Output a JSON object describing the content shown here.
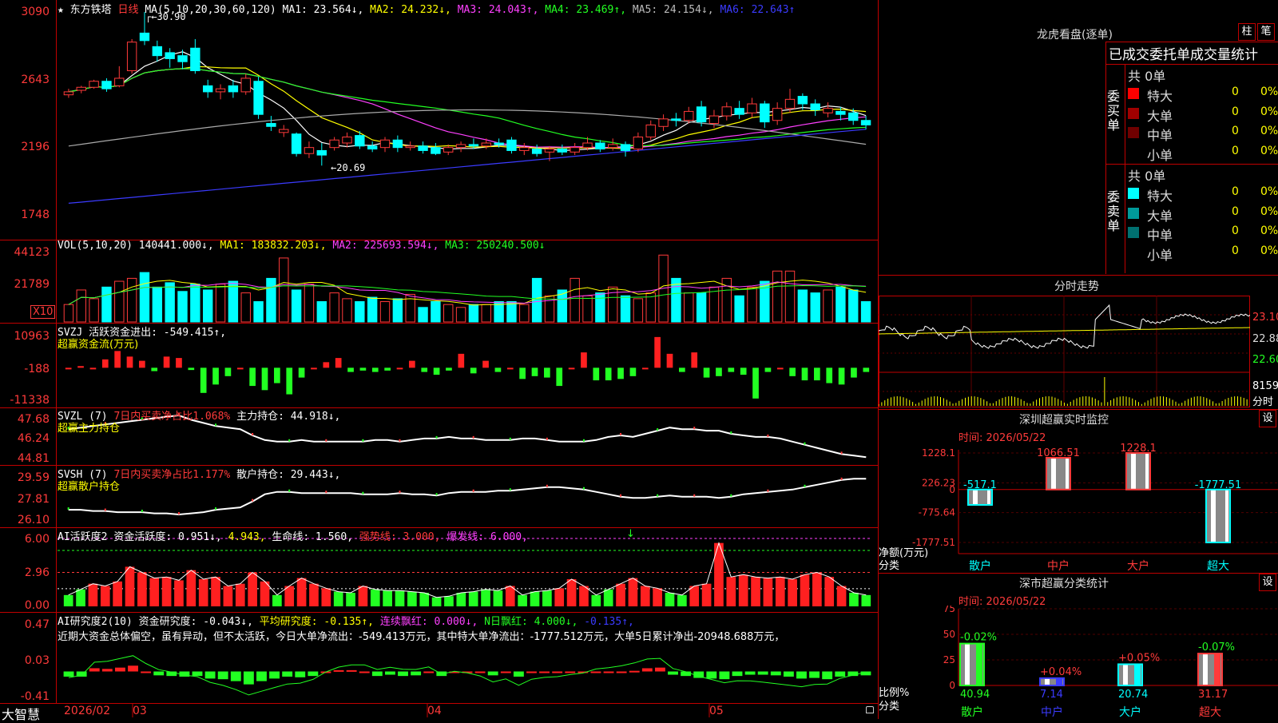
{
  "header": {
    "stock_name": "东方铁塔",
    "period": "日线",
    "ma_label": "MA(5,10,20,30,60,120)",
    "ma1": "MA1: 23.564↓,",
    "ma2": "MA2: 24.232↓,",
    "ma3": "MA3: 24.043↑,",
    "ma4": "MA4: 23.469↑,",
    "ma5": "MA5: 24.154↓,",
    "ma6": "MA6: 22.643↑"
  },
  "price_panel": {
    "ticks": [
      "3090",
      "2643",
      "2196",
      "1748"
    ],
    "high_note": "30.90",
    "low_note": "←20.69"
  },
  "vol_panel": {
    "label": "VOL(5,10,20)",
    "value": "140441.000↓,",
    "ma1": "MA1: 183832.203↓,",
    "ma2": "MA2: 225693.594↓,",
    "ma3": "MA3: 250240.500↓",
    "ticks": [
      "44123",
      "21789"
    ],
    "unit": "X10"
  },
  "svzj_panel": {
    "label": "SVZJ",
    "title": "活跃资金进出: -549.415↑,",
    "subtitle": "超赢资金流(万元)",
    "ticks": [
      "10963",
      "-188",
      "-11338"
    ]
  },
  "svzl_panel": {
    "label": "SVZL (7)",
    "ratio": "7日内买卖净占比1.068%",
    "value": "主力持仓: 44.918↓,",
    "subtitle": "超赢主力持仓",
    "ticks": [
      "47.68",
      "46.24",
      "44.81"
    ]
  },
  "svsh_panel": {
    "label": "SVSH (7)",
    "ratio": "7日内买卖净占比1.177%",
    "value": "散户持仓: 29.443↓,",
    "subtitle": "超赢散户持仓",
    "ticks": [
      "29.59",
      "27.81",
      "26.10"
    ]
  },
  "ai_active_panel": {
    "label": "AI活跃度2",
    "v1": "资金活跃度: 0.951↓,",
    "v2": "4.943,",
    "v3": "生命线: 1.560,",
    "v4": "强势线: 3.000,",
    "v5": "爆发线: 6.000,",
    "ticks": [
      "6.00",
      "2.96",
      "0.00"
    ]
  },
  "ai_research_panel": {
    "label": "AI研究度2(10)",
    "v1": "资金研究度: -0.043↓,",
    "v2": "平均研究度: -0.135↑,",
    "v3": "连续飘红: 0.000↓,",
    "v4": "N日飘红: 4.000↓,",
    "v5": "-0.135↑,",
    "note": "近期大资金总体偏空，虽有异动，但不太活跃，今日大单净流出：-549.413万元，其中特大单净流出：-1777.512万元，大单5日累计净出-20948.688万元，",
    "ticks": [
      "0.47",
      "0.03",
      "-0.41"
    ]
  },
  "x_axis": {
    "brand": "大智慧",
    "labels": [
      "2026/02",
      "03",
      "04",
      "05"
    ]
  },
  "right": {
    "dragon_title": "龙虎看盘(逐单)",
    "btn_col": "柱",
    "btn_pen": "笔",
    "stats_title": "已成交委托单成交量统计",
    "buy_side": "委买单",
    "sell_side": "委卖单",
    "buy_total": "共 0单",
    "sell_total": "共 0单",
    "buy_rows": [
      {
        "name": "特大",
        "count": "0",
        "pct": "0%",
        "color": "#ff0000"
      },
      {
        "name": "大单",
        "count": "0",
        "pct": "0%",
        "color": "#a00000"
      },
      {
        "name": "中单",
        "count": "0",
        "pct": "0%",
        "color": "#700000"
      },
      {
        "name": "小单",
        "count": "0",
        "pct": "0%",
        "color": ""
      }
    ],
    "sell_rows": [
      {
        "name": "特大",
        "count": "0",
        "pct": "0%",
        "color": "#00ffff"
      },
      {
        "name": "大单",
        "count": "0",
        "pct": "0%",
        "color": "#009a9a"
      },
      {
        "name": "中单",
        "count": "0",
        "pct": "0%",
        "color": "#007070"
      },
      {
        "name": "小单",
        "count": "0",
        "pct": "0%",
        "color": ""
      }
    ],
    "intraday_title": "分时走势",
    "intraday_ticks": [
      "23.10",
      "22.88",
      "22.60"
    ],
    "intraday_vol": "8159",
    "intraday_vol_unit": "分时",
    "monitor_title": "深圳超赢实时监控",
    "monitor_settings": "设",
    "monitor_time": "时间: 2026/05/22",
    "monitor_ticks": [
      "1228.1",
      "226.23",
      "0",
      "-775.64",
      "-1777.51"
    ],
    "monitor_ylabel": "净额(万元)",
    "monitor_xlabel": "分类",
    "class_title": "深市超赢分类统计",
    "class_settings": "设",
    "class_time": "时间: 2026/05/22",
    "class_ticks": [
      "75",
      "50",
      "25",
      "0"
    ],
    "class_ylabel": "比例%",
    "class_xlabel": "分类",
    "categories": [
      "散户",
      "中户",
      "大户",
      "超大"
    ]
  },
  "chart_data": [
    {
      "type": "candlestick",
      "title": "东方铁塔 日线",
      "ylim": [
        17.48,
        30.9
      ],
      "x_labels": [
        "2026/02",
        "03",
        "04",
        "05"
      ],
      "candles": [
        {
          "o": 25.4,
          "c": 25.6,
          "h": 25.8,
          "l": 25.2
        },
        {
          "o": 25.7,
          "c": 25.9,
          "h": 26.0,
          "l": 25.5
        },
        {
          "o": 25.9,
          "c": 26.3,
          "h": 26.4,
          "l": 25.8
        },
        {
          "o": 26.3,
          "c": 25.8,
          "h": 26.5,
          "l": 25.6
        },
        {
          "o": 26.0,
          "c": 26.5,
          "h": 27.3,
          "l": 25.9
        },
        {
          "o": 27.0,
          "c": 28.9,
          "h": 29.1,
          "l": 26.8
        },
        {
          "o": 29.5,
          "c": 29.0,
          "h": 30.9,
          "l": 28.7
        },
        {
          "o": 28.6,
          "c": 28.0,
          "h": 29.0,
          "l": 27.6
        },
        {
          "o": 28.2,
          "c": 27.8,
          "h": 28.5,
          "l": 27.2
        },
        {
          "o": 28.0,
          "c": 27.6,
          "h": 28.4,
          "l": 27.1
        },
        {
          "o": 28.5,
          "c": 27.0,
          "h": 29.1,
          "l": 26.8
        },
        {
          "o": 26.0,
          "c": 25.6,
          "h": 26.4,
          "l": 25.2
        },
        {
          "o": 25.6,
          "c": 25.8,
          "h": 26.1,
          "l": 25.1
        },
        {
          "o": 26.0,
          "c": 25.6,
          "h": 26.4,
          "l": 25.2
        },
        {
          "o": 25.6,
          "c": 26.5,
          "h": 26.8,
          "l": 25.4
        },
        {
          "o": 26.3,
          "c": 24.1,
          "h": 26.6,
          "l": 23.8
        },
        {
          "o": 23.5,
          "c": 23.3,
          "h": 24.0,
          "l": 23.0
        },
        {
          "o": 22.9,
          "c": 23.1,
          "h": 23.4,
          "l": 22.6
        },
        {
          "o": 22.8,
          "c": 21.5,
          "h": 22.9,
          "l": 21.3
        },
        {
          "o": 21.5,
          "c": 21.9,
          "h": 22.3,
          "l": 21.2
        },
        {
          "o": 21.7,
          "c": 21.4,
          "h": 22.2,
          "l": 20.7
        },
        {
          "o": 21.9,
          "c": 22.4,
          "h": 22.6,
          "l": 21.7
        },
        {
          "o": 22.2,
          "c": 22.6,
          "h": 22.9,
          "l": 21.9
        },
        {
          "o": 22.7,
          "c": 22.0,
          "h": 23.0,
          "l": 21.8
        },
        {
          "o": 22.0,
          "c": 21.8,
          "h": 22.3,
          "l": 21.6
        },
        {
          "o": 21.9,
          "c": 22.4,
          "h": 22.6,
          "l": 21.6
        },
        {
          "o": 22.4,
          "c": 21.9,
          "h": 22.7,
          "l": 21.6
        },
        {
          "o": 21.9,
          "c": 22.0,
          "h": 22.3,
          "l": 21.7
        },
        {
          "o": 22.0,
          "c": 21.7,
          "h": 22.3,
          "l": 21.5
        },
        {
          "o": 21.9,
          "c": 21.5,
          "h": 22.2,
          "l": 21.4
        },
        {
          "o": 21.6,
          "c": 21.9,
          "h": 22.1,
          "l": 21.4
        },
        {
          "o": 21.9,
          "c": 22.1,
          "h": 22.3,
          "l": 21.6
        },
        {
          "o": 22.1,
          "c": 22.0,
          "h": 22.5,
          "l": 21.8
        },
        {
          "o": 22.0,
          "c": 22.2,
          "h": 22.5,
          "l": 21.8
        },
        {
          "o": 22.2,
          "c": 22.1,
          "h": 22.5,
          "l": 21.9
        },
        {
          "o": 22.4,
          "c": 21.7,
          "h": 22.6,
          "l": 21.5
        },
        {
          "o": 21.7,
          "c": 21.9,
          "h": 22.2,
          "l": 21.4
        },
        {
          "o": 21.8,
          "c": 21.5,
          "h": 22.1,
          "l": 21.3
        },
        {
          "o": 21.6,
          "c": 21.8,
          "h": 22.0,
          "l": 21.0
        },
        {
          "o": 21.8,
          "c": 21.6,
          "h": 22.1,
          "l": 21.4
        },
        {
          "o": 21.6,
          "c": 21.9,
          "h": 22.2,
          "l": 21.4
        },
        {
          "o": 21.9,
          "c": 22.2,
          "h": 22.6,
          "l": 21.7
        },
        {
          "o": 22.2,
          "c": 21.8,
          "h": 22.4,
          "l": 21.6
        },
        {
          "o": 21.9,
          "c": 22.1,
          "h": 22.5,
          "l": 21.7
        },
        {
          "o": 22.1,
          "c": 21.7,
          "h": 22.3,
          "l": 21.3
        },
        {
          "o": 21.8,
          "c": 22.6,
          "h": 22.9,
          "l": 21.6
        },
        {
          "o": 22.6,
          "c": 23.4,
          "h": 23.7,
          "l": 22.4
        },
        {
          "o": 23.3,
          "c": 23.8,
          "h": 24.1,
          "l": 23.0
        },
        {
          "o": 23.8,
          "c": 23.7,
          "h": 24.2,
          "l": 23.3
        },
        {
          "o": 23.7,
          "c": 24.3,
          "h": 24.6,
          "l": 23.5
        },
        {
          "o": 24.6,
          "c": 23.6,
          "h": 25.0,
          "l": 23.3
        },
        {
          "o": 23.5,
          "c": 24.0,
          "h": 24.4,
          "l": 23.2
        },
        {
          "o": 24.0,
          "c": 24.6,
          "h": 24.9,
          "l": 23.7
        },
        {
          "o": 24.5,
          "c": 24.1,
          "h": 25.0,
          "l": 23.8
        },
        {
          "o": 24.2,
          "c": 24.8,
          "h": 25.2,
          "l": 23.9
        },
        {
          "o": 24.8,
          "c": 23.6,
          "h": 25.0,
          "l": 23.2
        },
        {
          "o": 23.7,
          "c": 24.5,
          "h": 24.9,
          "l": 23.4
        },
        {
          "o": 24.5,
          "c": 25.1,
          "h": 25.8,
          "l": 24.2
        },
        {
          "o": 25.3,
          "c": 24.8,
          "h": 25.5,
          "l": 24.4
        },
        {
          "o": 24.8,
          "c": 24.4,
          "h": 25.1,
          "l": 24.0
        },
        {
          "o": 24.2,
          "c": 24.5,
          "h": 24.9,
          "l": 23.9
        },
        {
          "o": 24.3,
          "c": 24.1,
          "h": 24.6,
          "l": 23.7
        },
        {
          "o": 24.2,
          "c": 23.7,
          "h": 24.5,
          "l": 23.4
        },
        {
          "o": 23.7,
          "c": 23.4,
          "h": 24.0,
          "l": 23.1
        }
      ],
      "ma_series": [
        {
          "name": "MA1",
          "color": "#ffffff"
        },
        {
          "name": "MA2",
          "color": "#ffff00"
        },
        {
          "name": "MA3",
          "color": "#ff40ff"
        },
        {
          "name": "MA4",
          "color": "#22ff22"
        },
        {
          "name": "MA5",
          "color": "#aaaaaa"
        },
        {
          "name": "MA6",
          "color": "#3b3bff"
        }
      ]
    },
    {
      "type": "bar",
      "title": "VOL(5,10,20)",
      "ylim": [
        0,
        50000
      ],
      "values": [
        12000,
        22000,
        16000,
        24000,
        28000,
        30000,
        34000,
        24000,
        27000,
        21000,
        26000,
        22000,
        26000,
        28000,
        20000,
        14000,
        30000,
        44000,
        22000,
        26000,
        14000,
        20000,
        16000,
        14000,
        17000,
        14000,
        16000,
        19000,
        10000,
        14000,
        12000,
        10000,
        12000,
        12000,
        14000,
        14000,
        12000,
        30000,
        18000,
        22000,
        30000,
        18000,
        20000,
        24000,
        18000,
        16000,
        20000,
        46000,
        30000,
        20000,
        20000,
        24000,
        30000,
        18000,
        24000,
        28000,
        35000,
        35000,
        22000,
        20000,
        22000,
        24000,
        22000,
        14000
      ]
    },
    {
      "type": "bar",
      "title": "超赢资金流(万元)",
      "ylim": [
        -11338,
        10963
      ],
      "values": [
        0,
        600,
        0,
        3000,
        6000,
        4000,
        2500,
        -1200,
        4000,
        3500,
        -800,
        -9000,
        -6000,
        -3000,
        0,
        -6500,
        -8000,
        -5500,
        -9500,
        -3500,
        0,
        2000,
        3500,
        -1500,
        -1000,
        -1500,
        -1000,
        0,
        2500,
        -1500,
        -2500,
        -1000,
        5000,
        -2000,
        2500,
        -1500,
        0,
        -4000,
        -3000,
        -3500,
        -6500,
        0,
        5500,
        -4500,
        -4500,
        -4000,
        -3000,
        0,
        11000,
        5000,
        -1500,
        5500,
        -3500,
        -3000,
        -1500,
        -2500,
        -11000,
        -1500,
        0,
        -3000,
        -4500,
        -4500,
        -5500,
        -6000,
        -3500,
        -1500
      ]
    },
    {
      "type": "line",
      "title": "超赢主力持仓",
      "ylim": [
        44.81,
        47.68
      ],
      "values": [
        46.8,
        46.9,
        47.0,
        47.1,
        47.2,
        47.3,
        47.4,
        47.5,
        47.6,
        47.68,
        47.4,
        47.2,
        47.0,
        46.9,
        46.8,
        46.4,
        46.1,
        46.0,
        46.0,
        46.1,
        46.0,
        46.0,
        46.0,
        46.0,
        46.0,
        46.1,
        46.1,
        46.0,
        46.1,
        46.2,
        46.2,
        46.3,
        46.2,
        46.2,
        46.1,
        46.1,
        46.1,
        46.2,
        46.2,
        46.1,
        46.0,
        46.0,
        46.0,
        46.1,
        46.3,
        46.4,
        46.3,
        46.5,
        46.7,
        46.9,
        46.8,
        46.8,
        46.7,
        46.7,
        46.5,
        46.4,
        46.3,
        46.3,
        46.2,
        46.0,
        45.8,
        45.6,
        45.4,
        45.2,
        45.1,
        45.0
      ]
    },
    {
      "type": "line",
      "title": "超赢散户持仓",
      "ylim": [
        26.1,
        29.59
      ],
      "values": [
        26.9,
        26.9,
        26.8,
        26.8,
        26.7,
        26.7,
        26.7,
        26.6,
        26.6,
        26.5,
        26.6,
        26.7,
        26.9,
        27.0,
        27.1,
        27.6,
        28.2,
        28.4,
        28.4,
        28.3,
        28.3,
        28.3,
        28.3,
        28.3,
        28.2,
        28.2,
        28.2,
        28.3,
        28.2,
        28.2,
        28.1,
        28.3,
        28.4,
        28.4,
        28.4,
        28.5,
        28.5,
        28.6,
        28.7,
        28.8,
        28.8,
        28.7,
        28.6,
        28.4,
        28.2,
        28.0,
        27.9,
        27.9,
        28.0,
        28.1,
        28.0,
        28.0,
        28.0,
        27.9,
        28.0,
        28.2,
        28.3,
        28.4,
        28.5,
        28.6,
        28.8,
        29.0,
        29.2,
        29.4,
        29.5,
        29.5
      ]
    },
    {
      "type": "bar",
      "title": "AI活跃度2",
      "ylim": [
        0,
        6.0
      ],
      "values": [
        1.0,
        1.5,
        2.0,
        1.8,
        2.2,
        3.5,
        3.0,
        2.5,
        2.6,
        2.3,
        3.2,
        2.4,
        2.6,
        1.8,
        2.0,
        3.0,
        2.2,
        1.0,
        1.8,
        2.5,
        2.0,
        1.6,
        1.3,
        1.2,
        1.8,
        1.5,
        1.4,
        1.4,
        1.3,
        1.2,
        0.8,
        0.9,
        1.2,
        1.3,
        1.5,
        1.4,
        1.8,
        1.0,
        1.3,
        1.4,
        1.6,
        2.4,
        1.8,
        1.0,
        1.5,
        2.0,
        2.5,
        1.8,
        1.6,
        1.2,
        1.0,
        1.8,
        2.0,
        5.6,
        2.6,
        2.8,
        2.6,
        2.5,
        2.6,
        2.4,
        2.8,
        3.0,
        2.6,
        1.8,
        1.2,
        1.0
      ],
      "lines": [
        "生命线",
        "强势线",
        "爆发线"
      ]
    },
    {
      "type": "bar",
      "title": "AI研究度2(10)",
      "ylim": [
        -0.41,
        0.47
      ],
      "values": [
        -0.05,
        -0.05,
        0.08,
        0.07,
        0.09,
        0.12,
        0.03,
        -0.03,
        -0.04,
        -0.05,
        -0.04,
        -0.08,
        -0.09,
        -0.12,
        -0.17,
        -0.12,
        -0.08,
        -0.05,
        -0.06,
        -0.04,
        0.02,
        0.05,
        0.05,
        0.03,
        -0.04,
        -0.02,
        -0.04,
        -0.03,
        0.02,
        -0.04,
        0.02,
        0.03,
        0.02,
        -0.03,
        0.02,
        -0.05,
        0.02,
        0.03,
        0.02,
        0.02,
        0.01,
        0.03,
        0.02,
        0.02,
        0.04,
        0.08,
        0.09,
        -0.02,
        -0.04,
        -0.07,
        -0.08,
        -0.09,
        -0.04,
        -0.02,
        -0.02,
        -0.03,
        -0.05,
        -0.08,
        -0.07,
        -0.09,
        -0.05,
        -0.04,
        -0.03
      ]
    },
    {
      "type": "bar",
      "title": "深圳超赢实时监控",
      "categories": [
        "散户",
        "中户",
        "大户",
        "超大"
      ],
      "values": [
        -517.1,
        1066.51,
        1228.1,
        -1777.51
      ],
      "ylim": [
        -1777.51,
        1228.1
      ]
    },
    {
      "type": "bar",
      "title": "深市超赢分类统计",
      "categories": [
        "散户",
        "中户",
        "大户",
        "超大"
      ],
      "values": [
        40.94,
        7.14,
        20.74,
        31.17
      ],
      "changes": [
        "-0.02%",
        "+0.04%",
        "+0.05%",
        "-0.07%"
      ],
      "ylim": [
        0,
        75
      ]
    }
  ]
}
